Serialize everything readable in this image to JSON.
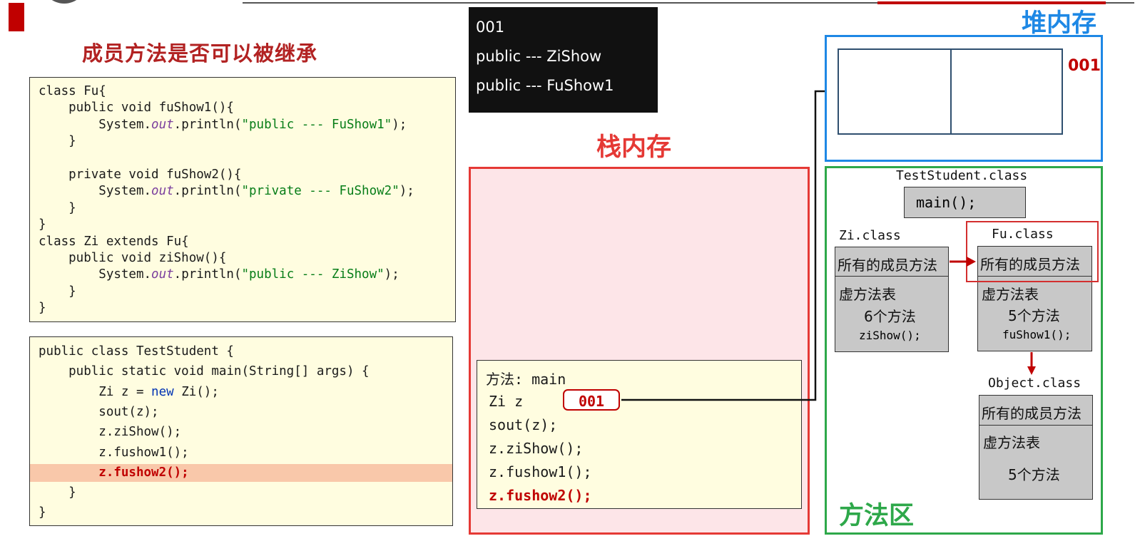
{
  "page": {
    "title": "成员方法是否可以被继承"
  },
  "code_fu_zi": [
    {
      "parts": [
        {
          "t": "class Fu{",
          "c": "plain"
        }
      ]
    },
    {
      "parts": [
        {
          "t": "    public void fuShow1(){",
          "c": "plain"
        }
      ]
    },
    {
      "parts": [
        {
          "t": "        System.",
          "c": "plain"
        },
        {
          "t": "out",
          "c": "it"
        },
        {
          "t": ".println(",
          "c": "plain"
        },
        {
          "t": "\"public --- FuShow1\"",
          "c": "str"
        },
        {
          "t": ");",
          "c": "plain"
        }
      ]
    },
    {
      "parts": [
        {
          "t": "    }",
          "c": "plain"
        }
      ]
    },
    {
      "parts": [
        {
          "t": "",
          "c": "plain"
        }
      ]
    },
    {
      "parts": [
        {
          "t": "    private void fuShow2(){",
          "c": "plain"
        }
      ]
    },
    {
      "parts": [
        {
          "t": "        System.",
          "c": "plain"
        },
        {
          "t": "out",
          "c": "it"
        },
        {
          "t": ".println(",
          "c": "plain"
        },
        {
          "t": "\"private --- FuShow2\"",
          "c": "str"
        },
        {
          "t": ");",
          "c": "plain"
        }
      ]
    },
    {
      "parts": [
        {
          "t": "    }",
          "c": "plain"
        }
      ]
    },
    {
      "parts": [
        {
          "t": "}",
          "c": "plain"
        }
      ]
    },
    {
      "parts": [
        {
          "t": "class Zi extends Fu{",
          "c": "plain"
        }
      ]
    },
    {
      "parts": [
        {
          "t": "    public void ziShow(){",
          "c": "plain"
        }
      ]
    },
    {
      "parts": [
        {
          "t": "        System.",
          "c": "plain"
        },
        {
          "t": "out",
          "c": "it"
        },
        {
          "t": ".println(",
          "c": "plain"
        },
        {
          "t": "\"public --- ZiShow\"",
          "c": "str"
        },
        {
          "t": ");",
          "c": "plain"
        }
      ]
    },
    {
      "parts": [
        {
          "t": "    }",
          "c": "plain"
        }
      ]
    },
    {
      "parts": [
        {
          "t": "}",
          "c": "plain"
        }
      ]
    }
  ],
  "code_test": [
    {
      "parts": [
        {
          "t": "public class TestStudent {",
          "c": "plain"
        }
      ]
    },
    {
      "parts": [
        {
          "t": "    public static void main(String[] args) {",
          "c": "plain"
        }
      ]
    },
    {
      "parts": [
        {
          "t": "        Zi z = ",
          "c": "plain"
        },
        {
          "t": "new",
          "c": "kw"
        },
        {
          "t": " Zi();",
          "c": "plain"
        }
      ]
    },
    {
      "parts": [
        {
          "t": "        sout(z);",
          "c": "plain"
        }
      ]
    },
    {
      "parts": [
        {
          "t": "        z.ziShow();",
          "c": "plain"
        }
      ]
    },
    {
      "parts": [
        {
          "t": "        z.fushow1();",
          "c": "plain"
        }
      ]
    },
    {
      "parts": [
        {
          "t": "        z.fushow2();",
          "c": "red"
        }
      ],
      "highlight": true
    },
    {
      "parts": [
        {
          "t": "    }",
          "c": "plain"
        }
      ]
    },
    {
      "parts": [
        {
          "t": "}",
          "c": "plain"
        }
      ]
    }
  ],
  "console": {
    "lines": [
      "001",
      "public --- ZiShow",
      "public --- FuShow1"
    ]
  },
  "stack": {
    "title": "栈内存",
    "frame_title": "方法: main",
    "var_label": "Zi z",
    "ref_value": "001",
    "lines": [
      "sout(z);",
      "z.ziShow();",
      "z.fushow1();"
    ],
    "current_line": "z.fushow2();"
  },
  "heap": {
    "title": "堆内存",
    "address": "001"
  },
  "method_area": {
    "title": "方法区",
    "teststudent_class": "TestStudent.class",
    "main_method": "main();",
    "zi": {
      "class_name": "Zi.class",
      "methods_header": "所有的成员方法",
      "vtable_label": "虚方法表",
      "count": "6个方法",
      "method": "ziShow();"
    },
    "fu": {
      "class_name": "Fu.class",
      "methods_header": "所有的成员方法",
      "vtable_label": "虚方法表",
      "count": "5个方法",
      "method": "fuShow1();"
    },
    "object": {
      "class_name": "Object.class",
      "methods_header": "所有的成员方法",
      "vtable_label": "虚方法表",
      "count": "5个方法"
    }
  },
  "colors": {
    "accent_red": "#c00000",
    "title_red": "#b22222",
    "heap_blue": "#1e88e5",
    "method_green": "#2ea84a",
    "stack_fill": "#fde5e8"
  }
}
